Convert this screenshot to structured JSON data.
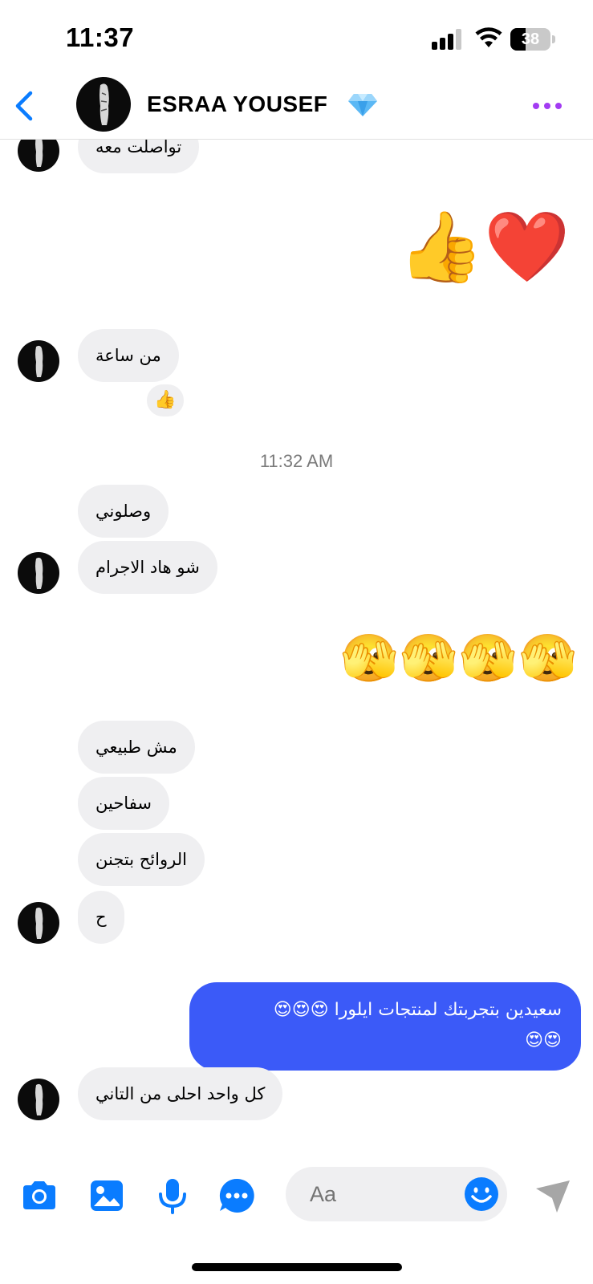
{
  "status_bar": {
    "time": "11:37",
    "battery_level": "38"
  },
  "header": {
    "contact_name": "ESRAA YOUSEF",
    "verified_badge_icon": "gem-icon",
    "back_icon": "chevron-left-icon",
    "more_icon": "more-dots-icon"
  },
  "messages": {
    "m1": "تواصلت معه",
    "m2_emojis": "👍❤️",
    "m3": "من ساعة",
    "m3_reaction": "👍",
    "timestamp": "11:32 AM",
    "m4": "وصلوني",
    "m5": "شو هاد الاجرام",
    "m6_emojis": "🫣🫣🫣🫣",
    "m7": "مش طبيعي",
    "m8": "سفاحين",
    "m9": "الروائح بتجنن",
    "m10": "ح",
    "sent_line1": "سعيدين بتجربتك لمنتجات ايلورا 😍😍😍",
    "sent_line2": "😍😍",
    "m11": "كل واحد احلى من التاني"
  },
  "composer": {
    "placeholder": "Aa",
    "icons": [
      "camera-icon",
      "image-icon",
      "microphone-icon",
      "more-icon",
      "emoji-icon",
      "send-icon"
    ]
  },
  "colors": {
    "accent_blue": "#0a7cff",
    "sent_bubble": "#3b5af8",
    "received_bubble": "#efeff1",
    "more_purple": "#a33cf2"
  }
}
